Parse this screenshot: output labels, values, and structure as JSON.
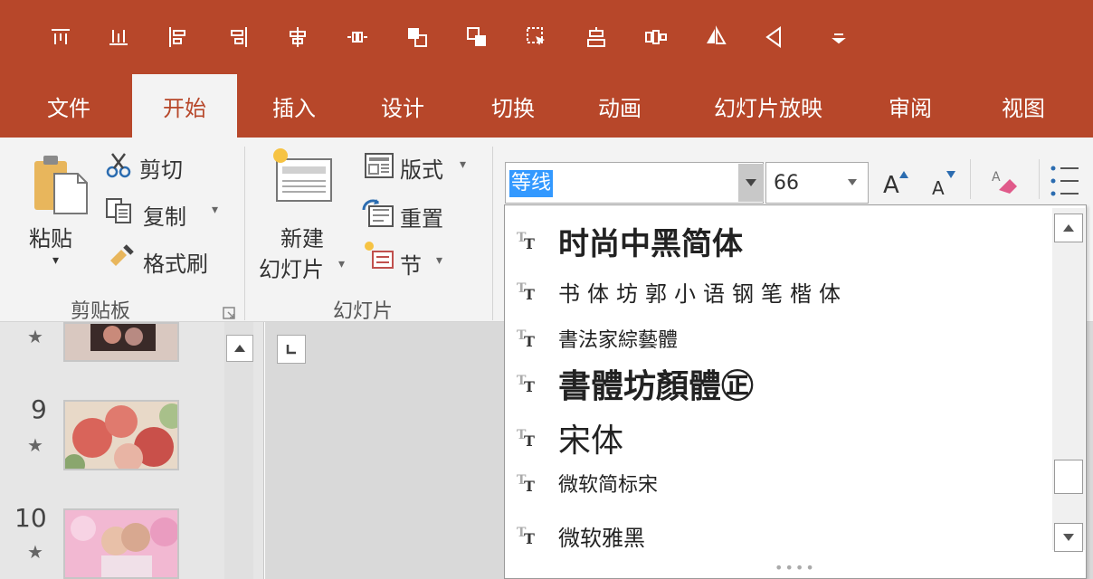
{
  "quick_access": {
    "icons": [
      "align-top-icon",
      "align-bottom-icon",
      "align-left-icon",
      "align-right-icon",
      "align-center-icon",
      "distribute-horizontal-icon",
      "bring-forward-icon",
      "send-backward-icon",
      "selection-pane-icon",
      "group-icon",
      "ungroup-icon",
      "flip-horizontal-icon",
      "flip-vertical-icon",
      "customize-qat-icon"
    ]
  },
  "tabs": [
    {
      "label": "文件",
      "active": false
    },
    {
      "label": "开始",
      "active": true
    },
    {
      "label": "插入",
      "active": false
    },
    {
      "label": "设计",
      "active": false
    },
    {
      "label": "切换",
      "active": false
    },
    {
      "label": "动画",
      "active": false
    },
    {
      "label": "幻灯片放映",
      "active": false
    },
    {
      "label": "审阅",
      "active": false
    },
    {
      "label": "视图",
      "active": false
    }
  ],
  "clipboard": {
    "paste": "粘贴",
    "cut": "剪切",
    "copy": "复制",
    "format_painter": "格式刷",
    "group_label": "剪贴板"
  },
  "slides_group": {
    "new_slide_line1": "新建",
    "new_slide_line2": "幻灯片",
    "layout": "版式",
    "reset": "重置",
    "section": "节",
    "group_label": "幻灯片"
  },
  "font": {
    "name": "等线",
    "size": "66",
    "grow": "A",
    "shrink": "A"
  },
  "font_list": [
    {
      "name": "时尚中黑简体"
    },
    {
      "name": "书体坊郭小语钢笔楷体"
    },
    {
      "name": "書法家綜藝體"
    },
    {
      "name": "書體坊顏體㊣"
    },
    {
      "name": "宋体"
    },
    {
      "name": "微软简标宋"
    },
    {
      "name": "微软雅黑"
    }
  ],
  "slide_panel": {
    "slides": [
      {
        "number": "",
        "star": "★"
      },
      {
        "number": "9",
        "star": "★"
      },
      {
        "number": "10",
        "star": "★"
      }
    ]
  },
  "colors": {
    "accent": "#b7472a",
    "ribbon_bg": "#f3f3f3",
    "selection": "#3399ff"
  }
}
